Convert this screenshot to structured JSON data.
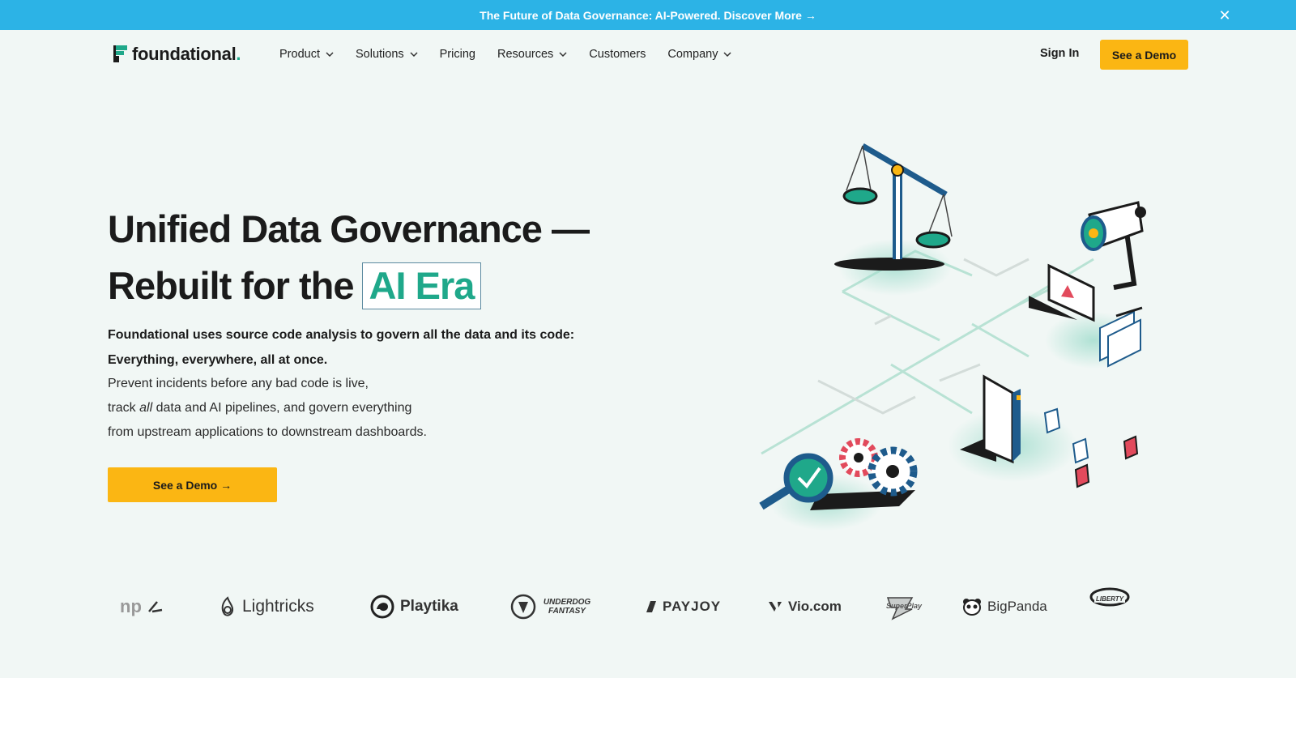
{
  "announcement": {
    "text": "The Future of Data Governance: AI-Powered. Discover More →",
    "close_icon": "close-icon"
  },
  "nav": {
    "logo_text": "foundational",
    "logo_dot": ".",
    "items": [
      {
        "label": "Product",
        "has_dropdown": true
      },
      {
        "label": "Solutions",
        "has_dropdown": true
      },
      {
        "label": "Pricing",
        "has_dropdown": false
      },
      {
        "label": "Resources",
        "has_dropdown": true
      },
      {
        "label": "Customers",
        "has_dropdown": false
      },
      {
        "label": "Company",
        "has_dropdown": true
      }
    ],
    "sign_in": "Sign In",
    "demo": "See a Demo"
  },
  "hero": {
    "title_line1": "Unified Data Governance —",
    "title_line2": "Rebuilt for the",
    "title_highlight": "AI Era",
    "bold_line1": "Foundational uses source code analysis to govern all the data and its code:",
    "bold_line2": "Everything, everywhere, all at once.",
    "body_line1": "Prevent incidents before any bad code is live,",
    "body_line2_pre": "track ",
    "body_line2_em": "all",
    "body_line2_post": " data and AI pipelines, and govern everything",
    "body_line3": "from upstream applications to downstream dashboards.",
    "cta": "See a Demo →"
  },
  "clients": [
    "np",
    "Lightricks",
    "Playtika",
    "UNDERDOG FANTASY",
    "PAYJOY",
    "Vio.com",
    "SuperPlay",
    "BigPanda",
    "LIBERTY"
  ],
  "colors": {
    "announcement_bg": "#2cb3e6",
    "accent_yellow": "#fbb613",
    "brand_teal": "#1fa88a",
    "hero_bg": "#f1f7f5"
  }
}
